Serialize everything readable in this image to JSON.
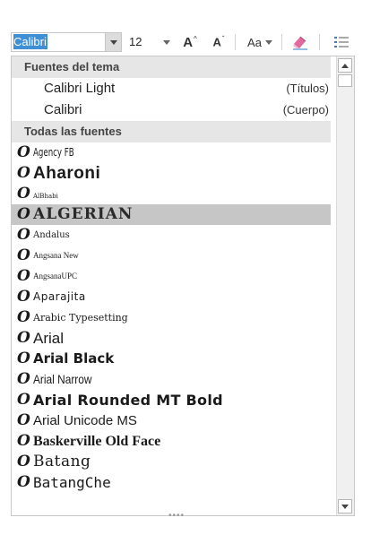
{
  "toolbar": {
    "font_name_value": "Calibri",
    "font_size_value": "12",
    "grow_font_label": "A",
    "shrink_font_label": "A",
    "change_case_label": "Aa",
    "dropdown_caret": "▾"
  },
  "font_dropdown": {
    "theme_section_title": "Fuentes del tema",
    "theme_fonts": [
      {
        "name": "Calibri Light",
        "role": "(Títulos)"
      },
      {
        "name": "Calibri",
        "role": "(Cuerpo)"
      }
    ],
    "all_section_title": "Todas las fuentes",
    "type_glyph": "O",
    "fonts": [
      {
        "name": "Agency FB",
        "selected": false
      },
      {
        "name": "Aharoni",
        "selected": false
      },
      {
        "name": "AlBhabi",
        "selected": false
      },
      {
        "name": "ALGERIAN",
        "selected": true
      },
      {
        "name": "Andalus",
        "selected": false
      },
      {
        "name": "Angsana New",
        "selected": false
      },
      {
        "name": "AngsanaUPC",
        "selected": false
      },
      {
        "name": "Aparajita",
        "selected": false
      },
      {
        "name": "Arabic Typesetting",
        "selected": false
      },
      {
        "name": "Arial",
        "selected": false
      },
      {
        "name": "Arial Black",
        "selected": false
      },
      {
        "name": "Arial Narrow",
        "selected": false
      },
      {
        "name": "Arial Rounded MT Bold",
        "selected": false
      },
      {
        "name": "Arial Unicode MS",
        "selected": false
      },
      {
        "name": "Baskerville Old Face",
        "selected": false
      },
      {
        "name": "Batang",
        "selected": false
      },
      {
        "name": "BatangChe",
        "selected": false
      }
    ]
  },
  "icons": {
    "dropdown_arrow": "chevron-down-icon",
    "grow_font": "grow-font-icon",
    "shrink_font": "shrink-font-icon",
    "clear_formatting": "eraser-icon",
    "bullets": "bullet-list-icon",
    "font_type": "opentype-icon",
    "scroll_up": "scroll-up-icon",
    "scroll_down": "scroll-down-icon"
  },
  "colors": {
    "selection_highlight": "#3f8fd6",
    "selected_row": "#c6c6c6",
    "section_header_bg": "#e6e6e6",
    "eraser_pink": "#e06a9a"
  }
}
